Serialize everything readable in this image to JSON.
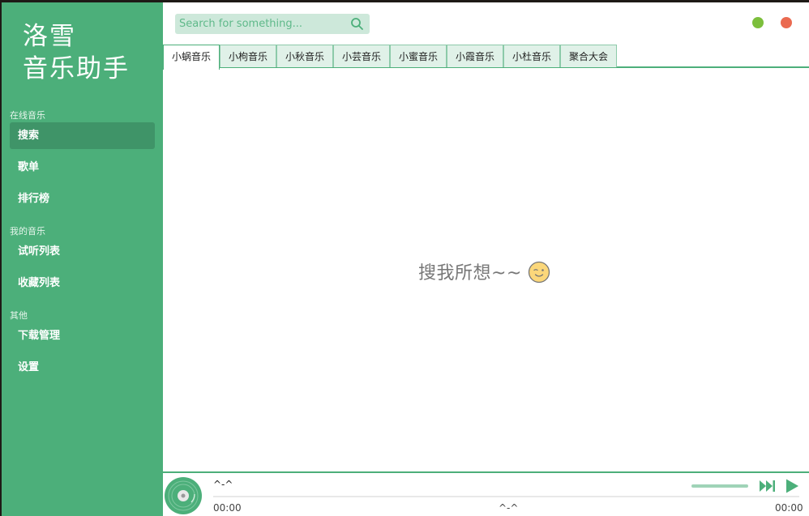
{
  "sidebar": {
    "logo_line1": "洛雪",
    "logo_line2": "音乐助手",
    "sections": [
      {
        "title": "在线音乐",
        "items": [
          {
            "label": "搜索",
            "active": true
          },
          {
            "label": "歌单"
          },
          {
            "label": "排行榜"
          }
        ]
      },
      {
        "title": "我的音乐",
        "items": [
          {
            "label": "试听列表"
          },
          {
            "label": "收藏列表"
          }
        ]
      },
      {
        "title": "其他",
        "items": [
          {
            "label": "下载管理"
          },
          {
            "label": "设置"
          }
        ]
      }
    ]
  },
  "search": {
    "placeholder": "Search for something...",
    "icon": "search-icon"
  },
  "window_controls": {
    "minimize_color": "#7cbf3c",
    "close_color": "#ea6a50"
  },
  "tabs": [
    {
      "label": "小蜗音乐",
      "active": true
    },
    {
      "label": "小枸音乐"
    },
    {
      "label": "小秋音乐"
    },
    {
      "label": "小芸音乐"
    },
    {
      "label": "小蜜音乐"
    },
    {
      "label": "小霞音乐"
    },
    {
      "label": "小杜音乐"
    },
    {
      "label": "聚合大会"
    }
  ],
  "content": {
    "empty_message": "搜我所想~~",
    "emoji_icon": "wink-face-icon"
  },
  "player": {
    "song_title": "^-^",
    "time_current": "00:00",
    "time_total": "00:00",
    "status_text": "^-^",
    "icons": [
      "disc-icon",
      "next-track-icon",
      "play-icon"
    ]
  },
  "colors": {
    "accent": "#4caf7a",
    "accent_dark": "#3f9468",
    "accent_light": "#cde8da"
  }
}
